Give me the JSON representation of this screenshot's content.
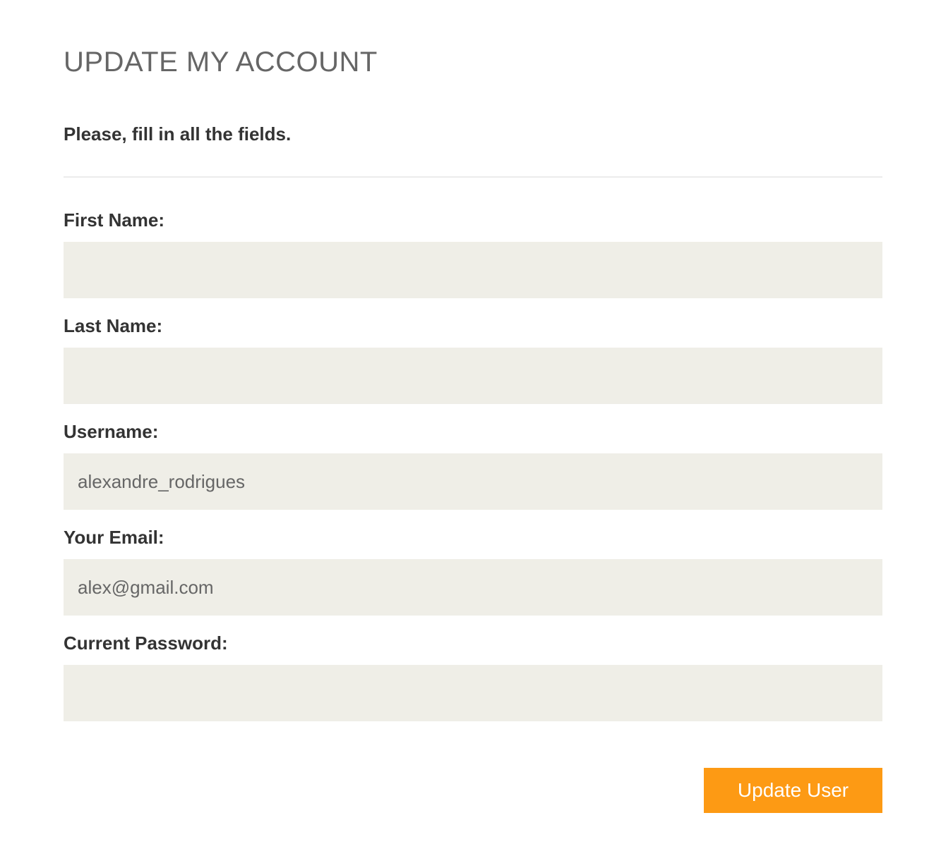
{
  "page": {
    "title": "UPDATE MY ACCOUNT",
    "intro": "Please, fill in all the fields."
  },
  "form": {
    "fields": [
      {
        "label": "First Name:",
        "value": ""
      },
      {
        "label": "Last Name:",
        "value": ""
      },
      {
        "label": "Username:",
        "value": "alexandre_rodrigues"
      },
      {
        "label": "Your Email:",
        "value": "alex@gmail.com"
      },
      {
        "label": "Current Password:",
        "value": ""
      }
    ],
    "submit_label": "Update User"
  },
  "colors": {
    "accent": "#fd9a14",
    "input_background": "#efeee7",
    "title": "#666666",
    "text": "#333333"
  }
}
